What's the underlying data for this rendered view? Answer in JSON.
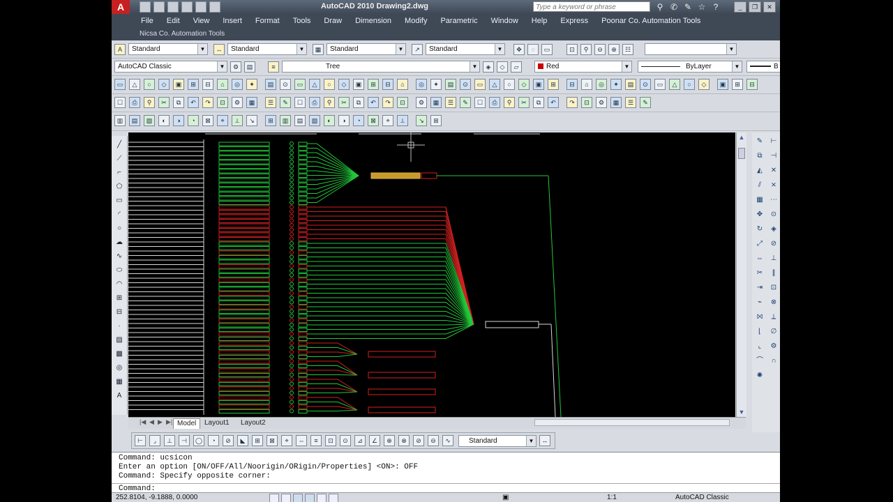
{
  "app": {
    "title": "AutoCAD 2010    Drawing2.dwg",
    "search_placeholder": "Type a keyword or phrase",
    "logo": "A"
  },
  "menu": [
    "File",
    "Edit",
    "View",
    "Insert",
    "Format",
    "Tools",
    "Draw",
    "Dimension",
    "Modify",
    "Parametric",
    "Window",
    "Help",
    "Express",
    "Poonar Co. Automation Tools"
  ],
  "menu2": "Nicsa Co. Automation Tools",
  "styles_toolbar": {
    "text_style": "Standard",
    "dim_style": "Standard",
    "table_style": "Standard",
    "mleader_style": "Standard"
  },
  "workspace": "AutoCAD Classic",
  "layer": "Tree",
  "color": "Red",
  "linetype": "ByLayer",
  "linetype2": "B",
  "tabs": [
    "Model",
    "Layout1",
    "Layout2"
  ],
  "dim_style_combo": "Standard",
  "command_lines": [
    "Command: ucsicon",
    "Enter an option [ON/OFF/All/Noorigin/ORigin/Properties] <ON>: OFF",
    "Command: Specify opposite corner:"
  ],
  "command_prompt": "Command:",
  "status": {
    "coords": "252.8104, -9.1888, 0.0000",
    "scale": "1:1",
    "workspace": "AutoCAD Classic"
  },
  "colors": {
    "green": "#21c83a",
    "red": "#d22020",
    "white": "#d8d8d8",
    "titlebar": "#46505e"
  }
}
